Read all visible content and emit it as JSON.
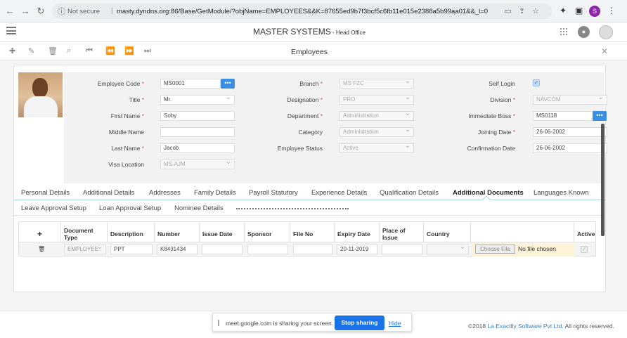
{
  "browser": {
    "security_label": "Not secure",
    "url": "masty.dyndns.org:86/Base/GetModule/?objName=EMPLOYEES&&K=87655ed9b7f3bcf5c6fb11e015e2388a5b99aa01&&_l=0",
    "profile_initial": "S",
    "icons": [
      "back-icon",
      "forward-icon",
      "reload-icon",
      "lock-icon",
      "extension-icon",
      "sidebar-icon",
      "menu-icon"
    ]
  },
  "header": {
    "app_name": "MASTER SYSTEMS",
    "branch_suffix": " - Head Office"
  },
  "toolbar": {
    "title": "Employees",
    "icons": [
      "add-icon",
      "edit-icon",
      "delete-icon",
      "search-icon",
      "first-icon",
      "previous-icon",
      "next-icon",
      "last-icon",
      "close-icon"
    ]
  },
  "form": {
    "employee_code": {
      "label": "Employee Code",
      "value": "MS0001",
      "required": true
    },
    "title": {
      "label": "Title",
      "value": "Mr.",
      "required": true
    },
    "first_name": {
      "label": "First Name",
      "value": "Soby",
      "required": true
    },
    "middle_name": {
      "label": "Middle Name",
      "value": ""
    },
    "last_name": {
      "label": "Last Name",
      "value": "Jacob",
      "required": true
    },
    "visa_location": {
      "label": "Visa Location",
      "value": "MS-AJM"
    },
    "branch": {
      "label": "Branch",
      "value": "MS FZC",
      "required": true
    },
    "designation": {
      "label": "Designation",
      "value": "PRO",
      "required": true
    },
    "department": {
      "label": "Department",
      "value": "Administration",
      "required": true
    },
    "category": {
      "label": "Category",
      "value": "Administration"
    },
    "employee_status": {
      "label": "Employee Status",
      "value": "Active"
    },
    "self_login": {
      "label": "Self Login",
      "checked": true
    },
    "division": {
      "label": "Division",
      "value": "NAVCOM",
      "required": true
    },
    "immediate_boss": {
      "label": "Immediate Boss",
      "value": "MS0118",
      "required": true
    },
    "joining_date": {
      "label": "Joining Date",
      "value": "26-06-2002",
      "required": true
    },
    "confirmation_date": {
      "label": "Confirmation Date",
      "value": "26-06-2002"
    },
    "required_mark": "*",
    "dots_label": "•••"
  },
  "tabs_primary": [
    "Personal Details",
    "Additional Details",
    "Addresses",
    "Family Details",
    "Payroll Statutory",
    "Experience Details",
    "Qualification Details",
    "Additional Documents",
    "Languages Known"
  ],
  "active_tab": "Additional Documents",
  "tabs_secondary": [
    "Leave Approval Setup",
    "Loan Approval Setup",
    "Nominee Details"
  ],
  "doc_grid": {
    "add_label": "+",
    "columns": [
      "Document Type",
      "Description",
      "Number",
      "Issue Date",
      "Sponsor",
      "File No",
      "Expiry Date",
      "Place of Issue",
      "Country",
      "",
      "Active"
    ],
    "row": {
      "document_type": "EMPLOYEE",
      "description": "PPT",
      "number": "K8431434",
      "issue_date": "",
      "sponsor": "",
      "file_no": "",
      "expiry_date": "20-11-2019",
      "place_of_issue": "",
      "country": "",
      "choose_file": "Choose File",
      "no_file": "No file chosen",
      "active": true
    }
  },
  "footer": {
    "copyright_prefix": "©2018 ",
    "company": "La Exactlly Software Pvt Ltd.",
    "rights": " All rights reserved."
  },
  "share_bar": {
    "text": "meet.google.com is sharing your screen.",
    "stop": "Stop sharing",
    "hide": "Hide"
  }
}
